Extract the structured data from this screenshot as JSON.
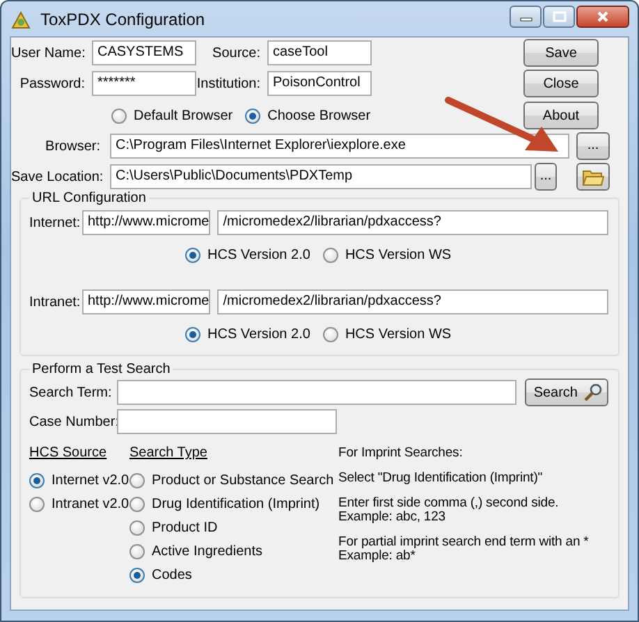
{
  "window": {
    "title": "ToxPDX Configuration"
  },
  "credentials": [
    {
      "label": "User Name:",
      "value": "CASYSTEMS"
    },
    {
      "label": "Source:",
      "value": "caseTool"
    },
    {
      "label": "Password:",
      "value": "*******"
    },
    {
      "label": "Institution:",
      "value": "PoisonControl"
    }
  ],
  "buttons": {
    "save": "Save",
    "close": "Close",
    "about": "About"
  },
  "browser_mode": [
    {
      "label": "Default Browser",
      "selected": false
    },
    {
      "label": "Choose Browser",
      "selected": true
    }
  ],
  "browser": {
    "label": "Browser:",
    "value": "C:\\Program Files\\Internet Explorer\\iexplore.exe",
    "browse_button": "..."
  },
  "save_location": {
    "label": "Save Location:",
    "value": "C:\\Users\\Public\\Documents\\PDXTemp",
    "browse_button": "..."
  },
  "url_configuration": {
    "title": "URL Configuration",
    "entries": [
      {
        "label": "Internet:",
        "host": "http://www.microme",
        "path": "/micromedex2/librarian/pdxaccess?",
        "versions": [
          {
            "label": "HCS Version 2.0",
            "selected": true
          },
          {
            "label": "HCS Version WS",
            "selected": false
          }
        ]
      },
      {
        "label": "Intranet:",
        "host": "http://www.microme",
        "path": "/micromedex2/librarian/pdxaccess?",
        "versions": [
          {
            "label": "HCS Version 2.0",
            "selected": true
          },
          {
            "label": "HCS Version WS",
            "selected": false
          }
        ]
      }
    ]
  },
  "test_search": {
    "title": "Perform a Test Search",
    "search_term": {
      "label": "Search Term:"
    },
    "search_button": "Search",
    "case_number": {
      "label": "Case Number:"
    },
    "hcs_source": {
      "title": "HCS Source",
      "options": [
        {
          "label": "Internet v2.0",
          "selected": true
        },
        {
          "label": "Intranet v2.0",
          "selected": false
        }
      ]
    },
    "search_type": {
      "title": "Search Type",
      "options": [
        {
          "label": "Product or Substance Search",
          "selected": false
        },
        {
          "label": "Drug Identification (Imprint)",
          "selected": false
        },
        {
          "label": "Product ID",
          "selected": false
        },
        {
          "label": "Active Ingredients",
          "selected": false
        },
        {
          "label": "Codes",
          "selected": true
        }
      ]
    },
    "notes": [
      [
        "For Imprint Searches:"
      ],
      [
        "Select \"Drug Identification (Imprint)\""
      ],
      [
        "Enter first side comma (,) second side.",
        "Example: abc, 123"
      ],
      [
        "For partial imprint search end term with an *",
        "Example: ab*"
      ]
    ]
  }
}
